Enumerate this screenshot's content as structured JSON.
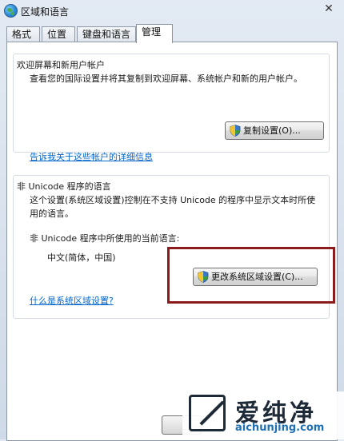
{
  "window": {
    "title": "区域和语言",
    "close_glyph": "✕"
  },
  "tabs": [
    {
      "label": "格式"
    },
    {
      "label": "位置"
    },
    {
      "label": "键盘和语言"
    },
    {
      "label": "管理",
      "selected": true
    }
  ],
  "welcome": {
    "title": "欢迎屏幕和新用户帐户",
    "description": "查看您的国际设置并将其复制到欢迎屏幕、系统帐户和新的用户帐户。",
    "copy_button": "复制设置(O)...",
    "link": "告诉我关于这些帐户的详细信息"
  },
  "non_unicode": {
    "title": "非 Unicode 程序的语言",
    "description_line1": "这个设置(系统区域设置)控制在不支持 Unicode 的程序中显示文本时所使",
    "description_line2": "用的语言。",
    "current_label": "非 Unicode 程序中所使用的当前语言:",
    "current_value": "中文(简体，中国)",
    "change_button": "更改系统区域设置(C)...",
    "link": "什么是系统区域设置?"
  },
  "watermark": {
    "text": "爱纯净",
    "url": "aichunjing.com"
  },
  "icons": {
    "title": "globe-icon",
    "close": "close-icon",
    "button": "uac-shield-icon"
  },
  "colors": {
    "link": "#0066cc",
    "highlight_border": "#8c1c1c",
    "window_frame": "#cfdae8"
  }
}
